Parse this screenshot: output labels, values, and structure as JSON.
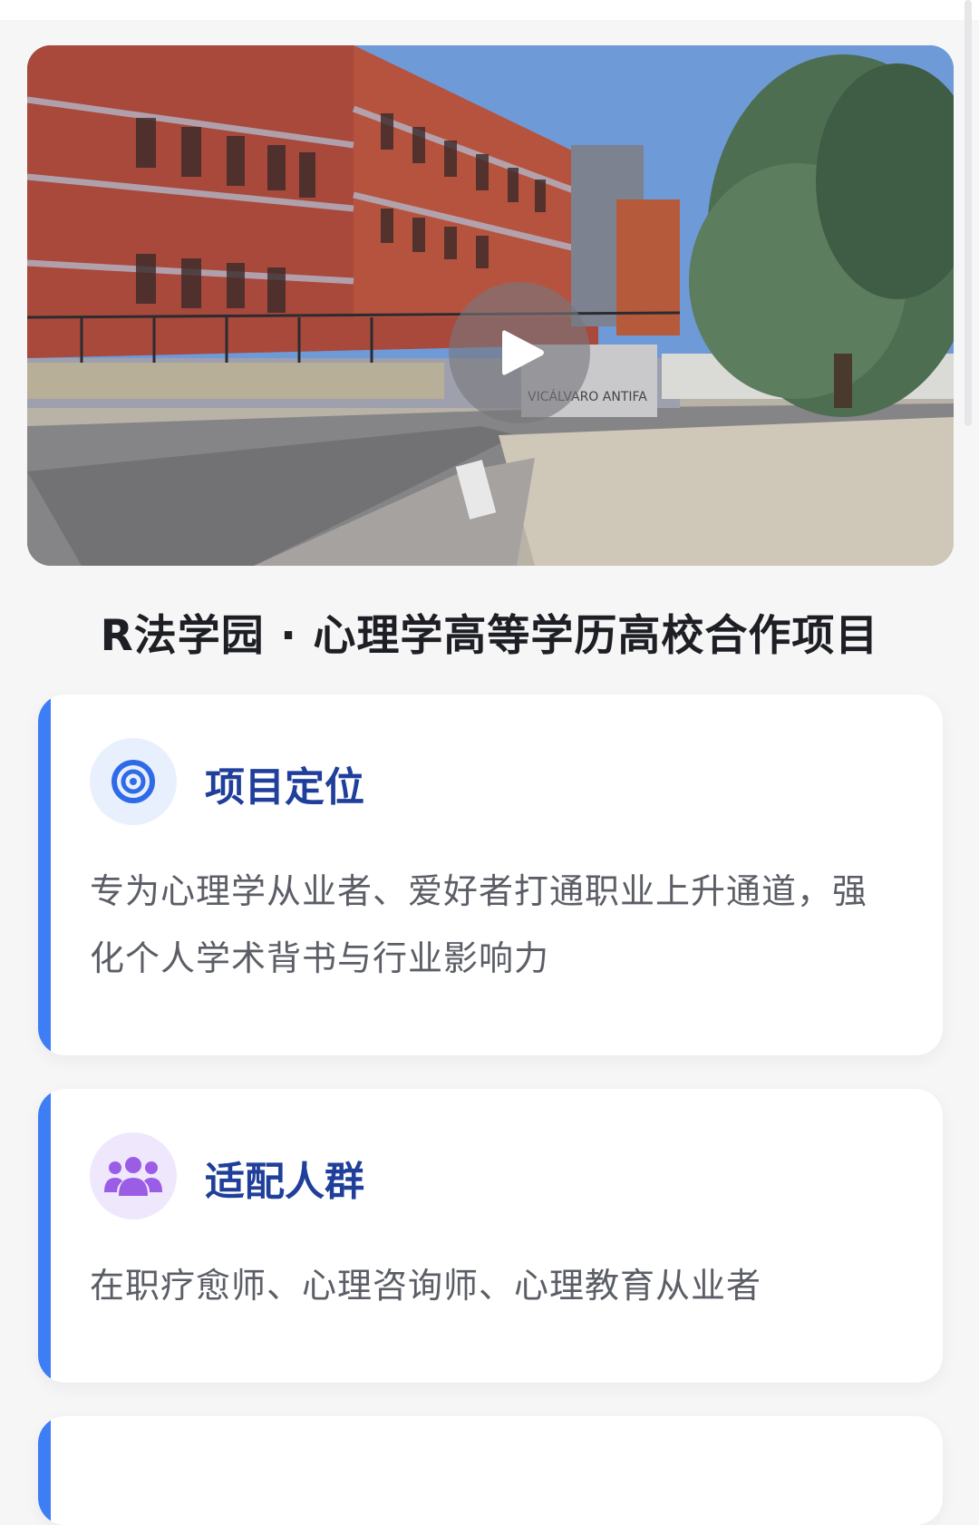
{
  "video": {
    "photo_signage": "VICÁLVARO ANTIFA",
    "play_icon": "play-icon"
  },
  "page_title": "R法学园 · 心理学高等学历高校合作项目",
  "cards": [
    {
      "icon": "target-icon",
      "icon_color": "#2f6be8",
      "title": "项目定位",
      "text": "专为心理学从业者、爱好者打通职业上升通道，强化个人学术背书与行业影响力"
    },
    {
      "icon": "users-group-icon",
      "icon_color": "#9b5de5",
      "title": "适配人群",
      "text": "在职疗愈师、心理咨询师、心理教育从业者"
    }
  ],
  "colors": {
    "accent_bar": "#3d7ef5",
    "card_title": "#1f3f9a",
    "page_bg": "#f6f6f7"
  }
}
